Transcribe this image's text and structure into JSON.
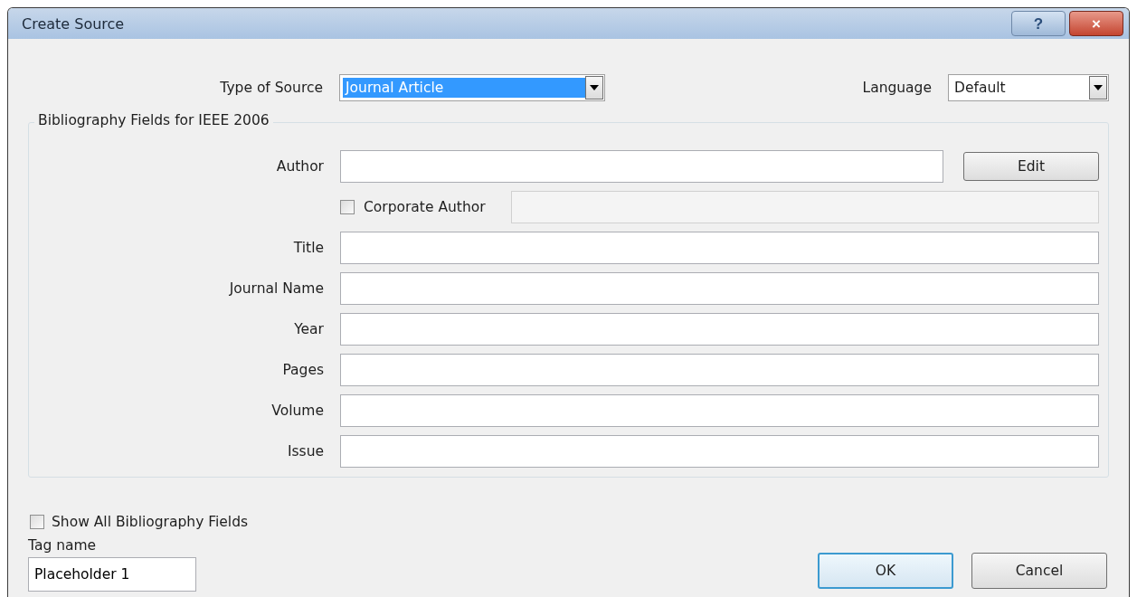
{
  "window": {
    "title": "Create Source",
    "help": "?",
    "close": "×"
  },
  "type_of_source": {
    "label": "Type of Source",
    "value": "Journal Article",
    "selected": true
  },
  "language": {
    "label": "Language",
    "value": "Default"
  },
  "group": {
    "title": "Bibliography Fields for IEEE 2006",
    "fields": [
      {
        "kind": "text",
        "label": "Author",
        "button": "Edit"
      },
      {
        "kind": "check",
        "label": "Corporate Author",
        "checked": false,
        "disabled": true
      },
      {
        "kind": "text",
        "label": "Title"
      },
      {
        "kind": "text",
        "label": "Journal Name"
      },
      {
        "kind": "text",
        "label": "Year"
      },
      {
        "kind": "text",
        "label": "Pages"
      },
      {
        "kind": "text",
        "label": "Volume"
      },
      {
        "kind": "text",
        "label": "Issue"
      }
    ]
  },
  "show_all": {
    "label": "Show All Bibliography Fields",
    "checked": false
  },
  "tag_name": {
    "label": "Tag name",
    "value": "Placeholder 1"
  },
  "buttons": [
    {
      "label": "OK",
      "default": true
    },
    {
      "label": "Cancel",
      "default": false
    }
  ]
}
